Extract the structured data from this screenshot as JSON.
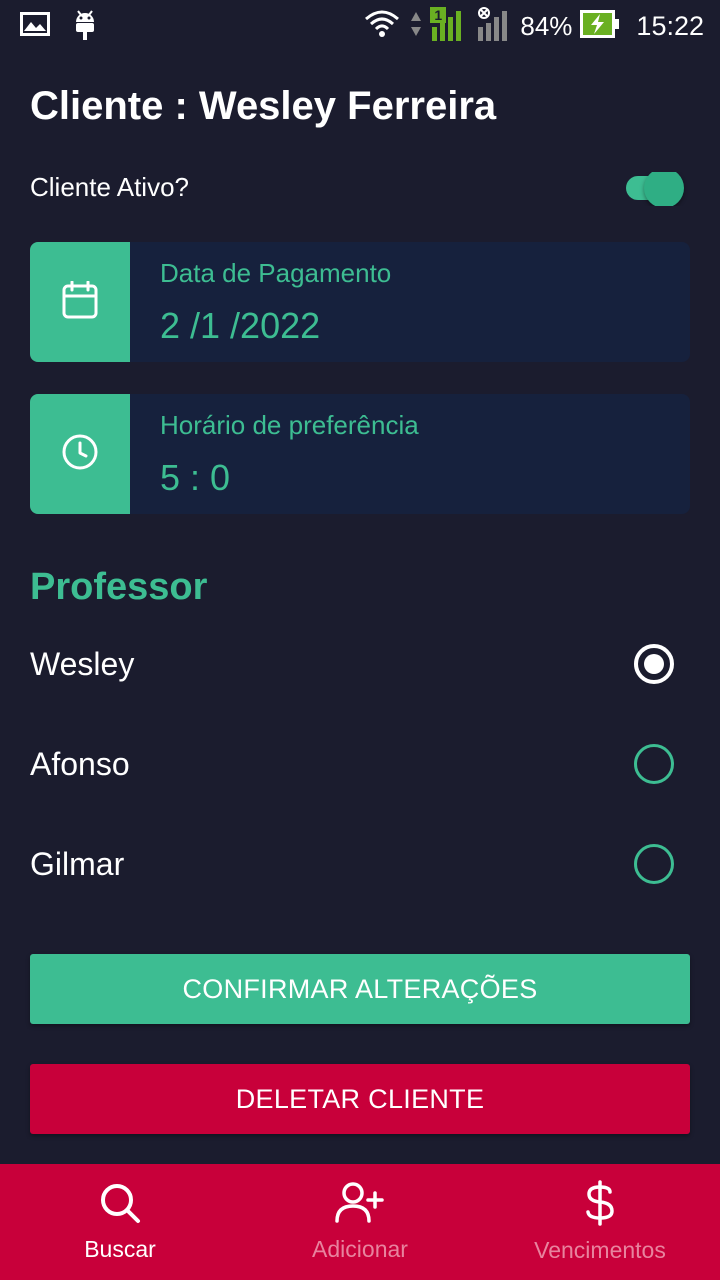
{
  "status_bar": {
    "battery_percent": "84%",
    "time": "15:22",
    "sim_badge": "1"
  },
  "header": {
    "title": "Cliente : Wesley Ferreira"
  },
  "active_toggle": {
    "label": "Cliente Ativo?",
    "checked": true
  },
  "payment_card": {
    "label": "Data de Pagamento",
    "value": "2 /1 /2022",
    "icon": "calendar-icon"
  },
  "time_card": {
    "label": "Horário de preferência",
    "value": "5 : 0",
    "icon": "clock-icon"
  },
  "professor": {
    "title": "Professor",
    "options": [
      {
        "label": "Wesley",
        "selected": true
      },
      {
        "label": "Afonso",
        "selected": false
      },
      {
        "label": "Gilmar",
        "selected": false
      }
    ]
  },
  "buttons": {
    "confirm": "CONFIRMAR ALTERAÇÕES",
    "delete": "DELETAR CLIENTE"
  },
  "bottom_nav": {
    "items": [
      {
        "label": "Buscar",
        "icon": "search-icon",
        "active": true
      },
      {
        "label": "Adicionar",
        "icon": "add-user-icon",
        "active": false
      },
      {
        "label": "Vencimentos",
        "icon": "dollar-icon",
        "active": false
      }
    ]
  },
  "colors": {
    "background": "#1b1c2e",
    "accent_green": "#3dbd92",
    "card_bg": "#16213d",
    "danger": "#c8003a"
  }
}
